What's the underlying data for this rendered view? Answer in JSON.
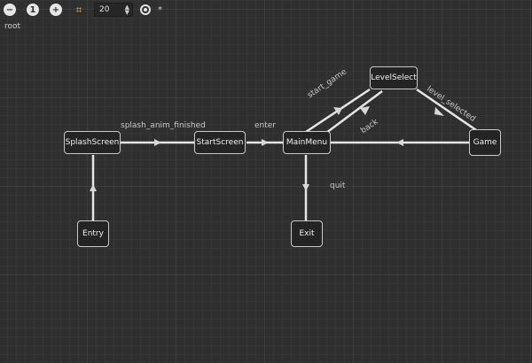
{
  "toolbar": {
    "zoom_out_icon": "minus-circle-icon",
    "zoom_reset_label": "1",
    "zoom_in_icon": "plus-circle-icon",
    "snap_icon": "grid-snap-icon",
    "snap_step_value": "20",
    "visibility_icon": "eye-icon",
    "modified_marker": "*"
  },
  "breadcrumb": {
    "path": "root"
  },
  "nodes": {
    "splash_screen": "SplashScreen",
    "start_screen": "StartScreen",
    "main_menu": "MainMenu",
    "level_select": "LevelSelect",
    "game": "Game",
    "entry": "Entry",
    "exit": "Exit"
  },
  "transitions": {
    "splash_anim_finished": "splash_anim_finished",
    "enter": "enter",
    "start_game": "start_game",
    "back": "back",
    "level_selected": "level_selected",
    "quit": "quit"
  },
  "colors": {
    "background": "#2f2f2f",
    "node_fill": "#242424",
    "node_border": "#c8c8c8",
    "line": "#e6e6e6",
    "snap_accent": "#e0b040"
  }
}
